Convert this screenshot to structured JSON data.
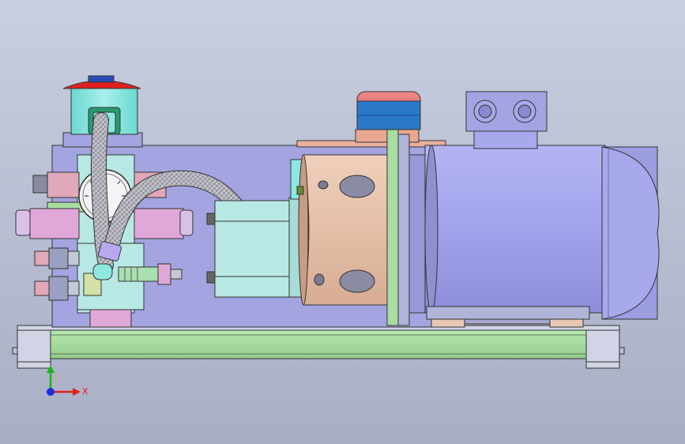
{
  "viewport": {
    "background_top": "#c9cfe0",
    "background_bottom": "#a9aec4"
  },
  "triad": {
    "x_label": "X",
    "y_label": "Y",
    "x_color": "#e0201c",
    "y_color": "#17b418",
    "z_color": "#1a2fe0"
  },
  "colors": {
    "tank": "#a4a4e0",
    "base_frame": "#a8dca0",
    "motor": "#a8a8f0",
    "bellhousing": "#e8c0a8",
    "pump": "#b8e8e4",
    "filter_cap": "#e02020",
    "filter_body": "#88e8e0",
    "breather": "#e07070",
    "hose": "#b0b0b8",
    "fitting_pink": "#e0a8d8",
    "fitting_lilac": "#b8a8f0"
  }
}
